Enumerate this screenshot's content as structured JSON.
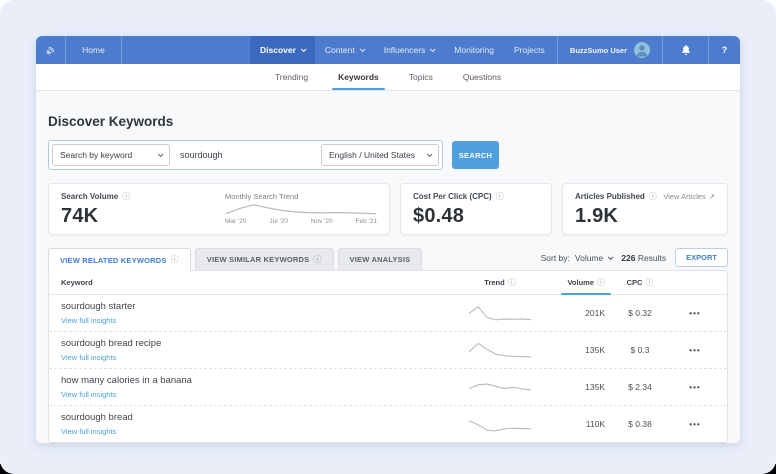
{
  "icons": {
    "info": "ⓘ",
    "external": "↗",
    "more": "•••",
    "help": "?"
  },
  "nav": {
    "items": [
      {
        "label": "Home"
      },
      {
        "label": "Discover"
      },
      {
        "label": "Content"
      },
      {
        "label": "Influencers"
      },
      {
        "label": "Monitoring"
      },
      {
        "label": "Projects"
      }
    ],
    "user_label": "BuzzSumo User"
  },
  "subtabs": {
    "items": [
      {
        "label": "Trending"
      },
      {
        "label": "Keywords"
      },
      {
        "label": "Topics"
      },
      {
        "label": "Questions"
      }
    ]
  },
  "page": {
    "title": "Discover Keywords"
  },
  "search": {
    "type_selector": "Search by keyword",
    "query": "sourdough",
    "locale_selector": "English / United States",
    "button_label": "SEARCH"
  },
  "stats": {
    "volume": {
      "label": "Search Volume",
      "value": "74K"
    },
    "monthly_trend": {
      "label": "Monthly Search Trend",
      "ticks": [
        "Mar '20",
        "Jul '20",
        "Nov '20",
        "Feb '21"
      ],
      "points": [
        0.85,
        0.45,
        0.18,
        0.4,
        0.6,
        0.72,
        0.78,
        0.8,
        0.78,
        0.8,
        0.82,
        0.86
      ]
    },
    "cpc": {
      "label": "Cost Per Click (CPC)",
      "value": "$0.48"
    },
    "articles": {
      "label": "Articles Published",
      "value": "1.9K",
      "link_label": "View Articles"
    }
  },
  "view_tabs": {
    "related": "VIEW RELATED KEYWORDS",
    "similar": "VIEW SIMILAR KEYWORDS",
    "analysis": "VIEW ANALYSIS"
  },
  "toolbar": {
    "sort_label": "Sort by:",
    "sort_value": "Volume",
    "results_count": "226",
    "results_label": "Results",
    "export_label": "EXPORT"
  },
  "table": {
    "headers": {
      "keyword": "Keyword",
      "trend": "Trend",
      "volume": "Volume",
      "cpc": "CPC"
    },
    "insights_link": "View full insights",
    "rows": [
      {
        "keyword": "sourdough starter",
        "volume": "201K",
        "cpc": "$ 0.32",
        "trend_points": [
          0.5,
          0.08,
          0.78,
          0.95,
          0.9,
          0.92,
          0.9,
          0.94
        ]
      },
      {
        "keyword": "sourdough bread recipe",
        "volume": "135K",
        "cpc": "$ 0.3",
        "trend_points": [
          0.6,
          0.06,
          0.45,
          0.78,
          0.88,
          0.92,
          0.94,
          0.95
        ]
      },
      {
        "keyword": "how many calories in a banana",
        "volume": "135K",
        "cpc": "$ 2.34",
        "trend_points": [
          0.6,
          0.35,
          0.3,
          0.45,
          0.6,
          0.52,
          0.62,
          0.7
        ]
      },
      {
        "keyword": "sourdough bread",
        "volume": "110K",
        "cpc": "$ 0.38",
        "trend_points": [
          0.3,
          0.55,
          0.92,
          0.95,
          0.82,
          0.78,
          0.8,
          0.82
        ]
      }
    ]
  }
}
